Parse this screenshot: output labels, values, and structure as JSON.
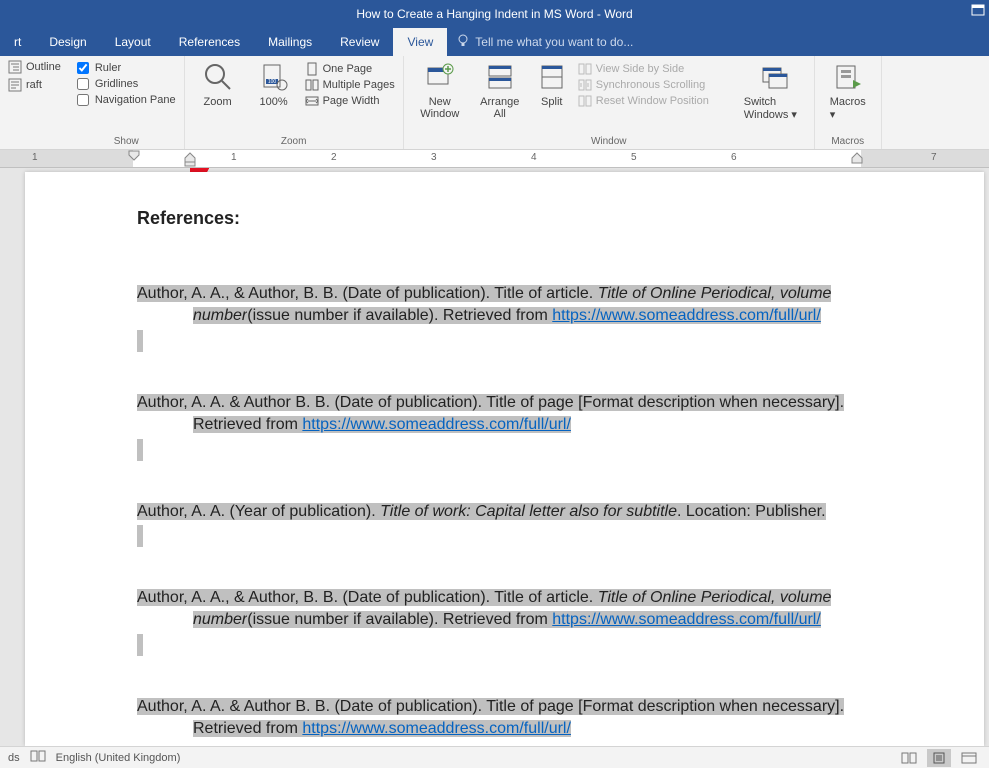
{
  "title": "How to Create a Hanging Indent in MS Word - Word",
  "tabs": {
    "rt": "rt",
    "design": "Design",
    "layout": "Layout",
    "references": "References",
    "mailings": "Mailings",
    "review": "Review",
    "view": "View"
  },
  "tellme": "Tell me what you want to do...",
  "outline": "Outline",
  "draft": "raft",
  "show": {
    "ruler": "Ruler",
    "gridlines": "Gridlines",
    "navpane": "Navigation Pane",
    "label": "Show"
  },
  "zoom": {
    "zoom": "Zoom",
    "hundred": "100%",
    "onepage": "One Page",
    "multiple": "Multiple Pages",
    "pagewidth": "Page Width",
    "label": "Zoom"
  },
  "window": {
    "new": "New Window",
    "arrange": "Arrange All",
    "split": "Split",
    "sidebyside": "View Side by Side",
    "sync": "Synchronous Scrolling",
    "reset": "Reset Window Position",
    "switch": "Switch Windows",
    "label": "Window"
  },
  "macros": {
    "macros": "Macros",
    "label": "Macros"
  },
  "doc": {
    "heading": "References:",
    "ref1_a": "Author, A. A., & Author, B. B. (Date of publication). Title of article. ",
    "ref1_b": "Title of Online Periodical, volume number",
    "ref1_c": "(issue number if available). Retrieved from ",
    "ref1_url": "https://www.someaddress.com/full/url/",
    "ref2_a": "Author, A. A. & Author B. B. (Date of publication). Title of page [Format description when necessary]. Retrieved from ",
    "ref2_url": "https://www.someaddress.com/full/url/",
    "ref3_a": "Author, A. A. (Year of publication). ",
    "ref3_b": "Title of work: Capital letter also for subtitle",
    "ref3_c": ". Location: Publisher.",
    "ref4_a": "Author, A. A., & Author, B. B. (Date of publication). Title of article. ",
    "ref4_b": "Title of Online Periodical, volume number",
    "ref4_c": "(issue number if available). Retrieved from ",
    "ref4_url": "https://www.someaddress.com/full/url/",
    "ref5_a": "Author, A. A. & Author B. B. (Date of publication). Title of page [Format description when necessary]. Retrieved from ",
    "ref5_url": "https://www.someaddress.com/full/url/"
  },
  "status": {
    "ds": "ds",
    "lang": "English (United Kingdom)"
  }
}
